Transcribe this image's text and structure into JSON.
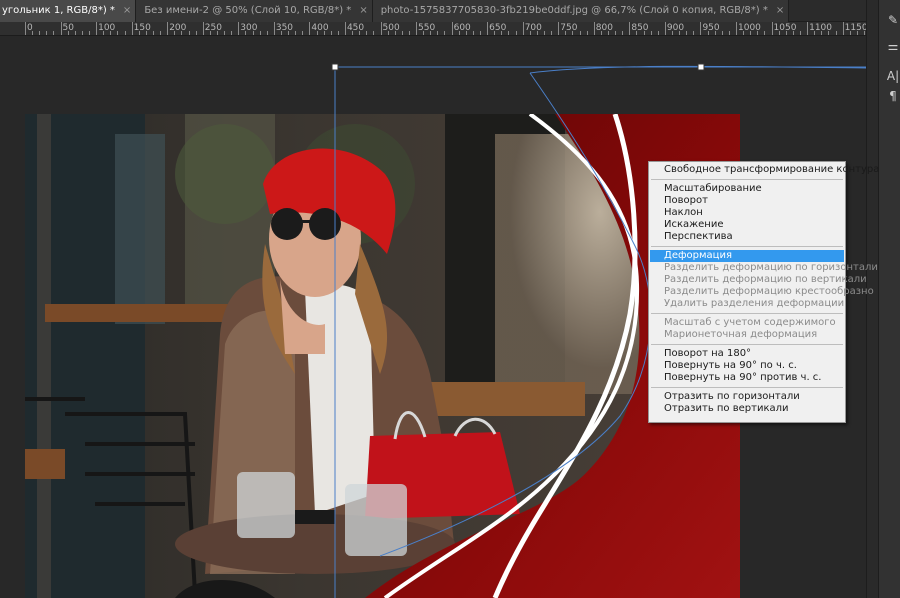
{
  "tabs": [
    {
      "label": "угольник 1, RGB/8*) *",
      "active": true
    },
    {
      "label": "Без имени-2 @ 50% (Слой 10, RGB/8*) *",
      "active": false
    },
    {
      "label": "photo-1575837705830-3fb219be0ddf.jpg @ 66,7% (Слой 0 копия, RGB/8*) *",
      "active": false
    }
  ],
  "tab_close": "×",
  "ruler": {
    "labels": [
      "0",
      "50",
      "100",
      "150",
      "200",
      "250",
      "300",
      "350",
      "400",
      "450",
      "500",
      "550",
      "600",
      "650",
      "700",
      "750",
      "800",
      "850",
      "900",
      "950",
      "1000",
      "1050",
      "1100",
      "1150"
    ]
  },
  "menu": {
    "groups": [
      [
        {
          "label": "Свободное трансформирование контура",
          "enabled": true
        }
      ],
      [
        {
          "label": "Масштабирование",
          "enabled": true
        },
        {
          "label": "Поворот",
          "enabled": true
        },
        {
          "label": "Наклон",
          "enabled": true
        },
        {
          "label": "Искажение",
          "enabled": true
        },
        {
          "label": "Перспектива",
          "enabled": true
        }
      ],
      [
        {
          "label": "Деформация",
          "enabled": true,
          "selected": true
        },
        {
          "label": "Разделить деформацию по горизонтали",
          "enabled": false
        },
        {
          "label": "Разделить деформацию по вертикали",
          "enabled": false
        },
        {
          "label": "Разделить деформацию крестообразно",
          "enabled": false
        },
        {
          "label": "Удалить разделения деформации",
          "enabled": false
        }
      ],
      [
        {
          "label": "Масштаб с учетом содержимого",
          "enabled": false
        },
        {
          "label": "Марионеточная деформация",
          "enabled": false
        }
      ],
      [
        {
          "label": "Поворот на 180°",
          "enabled": true
        },
        {
          "label": "Повернуть на 90° по ч. с.",
          "enabled": true
        },
        {
          "label": "Повернуть на 90° против ч. с.",
          "enabled": true
        }
      ],
      [
        {
          "label": "Отразить по горизонтали",
          "enabled": true
        },
        {
          "label": "Отразить по вертикали",
          "enabled": true
        }
      ]
    ]
  },
  "panel_icons": [
    {
      "name": "brush-settings-icon",
      "glyph": "✎"
    },
    {
      "name": "adjustments-icon",
      "glyph": "⚌"
    },
    {
      "name": "character-icon",
      "glyph": "A|"
    },
    {
      "name": "paragraph-icon",
      "glyph": "¶"
    }
  ],
  "colors": {
    "accent_selection": "#3399ee",
    "banner_red": "#8b0a0a",
    "path_blue": "#4a7fc8"
  }
}
